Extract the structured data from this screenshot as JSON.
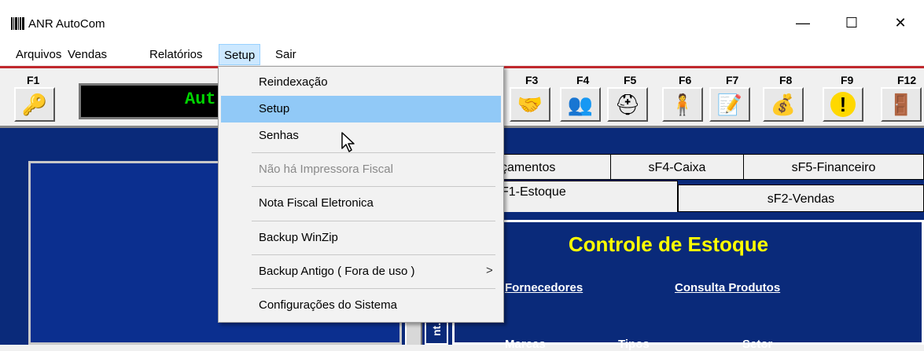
{
  "window": {
    "title": "ANR AutoCom",
    "minimize": "—",
    "maximize": "☐",
    "close": "✕"
  },
  "menu": [
    "Arquivos",
    "Vendas",
    "Relatórios",
    "Setup",
    "Sair"
  ],
  "toolbar": {
    "keys": [
      "F1",
      "F3",
      "F4",
      "F5",
      "F6",
      "F7",
      "F8",
      "F9",
      "F12"
    ],
    "icons": [
      "key-icon",
      "handshake-icon",
      "people-icon",
      "hardhat-icon",
      "person-icon",
      "notepad-icon",
      "money-bag-icon",
      "warning-icon",
      "exit-door-icon"
    ],
    "display_text": "Aut"
  },
  "setup_menu": {
    "items": [
      {
        "label": "Reindexação",
        "state": "normal"
      },
      {
        "label": "Setup",
        "state": "highlighted"
      },
      {
        "label": "Senhas",
        "state": "normal"
      },
      {
        "label": "Não há Impressora Fiscal",
        "state": "disabled"
      },
      {
        "label": "Nota Fiscal Eletronica",
        "state": "normal"
      },
      {
        "label": "Backup WinZip",
        "state": "normal"
      },
      {
        "label": "Backup Antigo ( Fora de uso )",
        "state": "normal",
        "submenu_arrow": ">"
      },
      {
        "label": "Configurações do Sistema",
        "state": "normal"
      }
    ]
  },
  "tabs": {
    "row1": [
      "çamentos",
      "sF4-Caixa",
      "sF5-Financeiro"
    ],
    "row2": [
      "F1-Estoque",
      "sF2-Vendas"
    ]
  },
  "content": {
    "title": "Controle de Estoque",
    "links": [
      "Fornecedores",
      "Consulta Produtos"
    ],
    "columns": [
      "Marcas",
      "Tipos",
      "Setor"
    ],
    "side_tab": "nt."
  },
  "colors": {
    "menu_highlight": "#91c9f7",
    "main_bg": "#0a2a7a",
    "title_yellow": "#ffff00",
    "display_green": "#00d400",
    "accent_red": "#c0282d"
  }
}
